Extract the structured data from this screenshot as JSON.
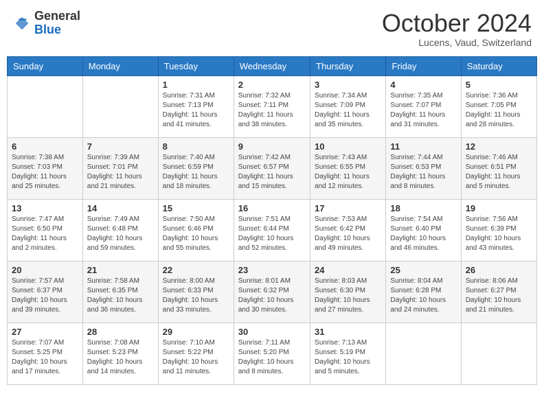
{
  "logo": {
    "general": "General",
    "blue": "Blue"
  },
  "title": "October 2024",
  "subtitle": "Lucens, Vaud, Switzerland",
  "days_of_week": [
    "Sunday",
    "Monday",
    "Tuesday",
    "Wednesday",
    "Thursday",
    "Friday",
    "Saturday"
  ],
  "weeks": [
    [
      null,
      null,
      {
        "day": "1",
        "sunrise": "7:31 AM",
        "sunset": "7:13 PM",
        "daylight": "11 hours and 41 minutes."
      },
      {
        "day": "2",
        "sunrise": "7:32 AM",
        "sunset": "7:11 PM",
        "daylight": "11 hours and 38 minutes."
      },
      {
        "day": "3",
        "sunrise": "7:34 AM",
        "sunset": "7:09 PM",
        "daylight": "11 hours and 35 minutes."
      },
      {
        "day": "4",
        "sunrise": "7:35 AM",
        "sunset": "7:07 PM",
        "daylight": "11 hours and 31 minutes."
      },
      {
        "day": "5",
        "sunrise": "7:36 AM",
        "sunset": "7:05 PM",
        "daylight": "11 hours and 28 minutes."
      }
    ],
    [
      {
        "day": "6",
        "sunrise": "7:38 AM",
        "sunset": "7:03 PM",
        "daylight": "11 hours and 25 minutes."
      },
      {
        "day": "7",
        "sunrise": "7:39 AM",
        "sunset": "7:01 PM",
        "daylight": "11 hours and 21 minutes."
      },
      {
        "day": "8",
        "sunrise": "7:40 AM",
        "sunset": "6:59 PM",
        "daylight": "11 hours and 18 minutes."
      },
      {
        "day": "9",
        "sunrise": "7:42 AM",
        "sunset": "6:57 PM",
        "daylight": "11 hours and 15 minutes."
      },
      {
        "day": "10",
        "sunrise": "7:43 AM",
        "sunset": "6:55 PM",
        "daylight": "11 hours and 12 minutes."
      },
      {
        "day": "11",
        "sunrise": "7:44 AM",
        "sunset": "6:53 PM",
        "daylight": "11 hours and 8 minutes."
      },
      {
        "day": "12",
        "sunrise": "7:46 AM",
        "sunset": "6:51 PM",
        "daylight": "11 hours and 5 minutes."
      }
    ],
    [
      {
        "day": "13",
        "sunrise": "7:47 AM",
        "sunset": "6:50 PM",
        "daylight": "11 hours and 2 minutes."
      },
      {
        "day": "14",
        "sunrise": "7:49 AM",
        "sunset": "6:48 PM",
        "daylight": "10 hours and 59 minutes."
      },
      {
        "day": "15",
        "sunrise": "7:50 AM",
        "sunset": "6:46 PM",
        "daylight": "10 hours and 55 minutes."
      },
      {
        "day": "16",
        "sunrise": "7:51 AM",
        "sunset": "6:44 PM",
        "daylight": "10 hours and 52 minutes."
      },
      {
        "day": "17",
        "sunrise": "7:53 AM",
        "sunset": "6:42 PM",
        "daylight": "10 hours and 49 minutes."
      },
      {
        "day": "18",
        "sunrise": "7:54 AM",
        "sunset": "6:40 PM",
        "daylight": "10 hours and 46 minutes."
      },
      {
        "day": "19",
        "sunrise": "7:56 AM",
        "sunset": "6:39 PM",
        "daylight": "10 hours and 43 minutes."
      }
    ],
    [
      {
        "day": "20",
        "sunrise": "7:57 AM",
        "sunset": "6:37 PM",
        "daylight": "10 hours and 39 minutes."
      },
      {
        "day": "21",
        "sunrise": "7:58 AM",
        "sunset": "6:35 PM",
        "daylight": "10 hours and 36 minutes."
      },
      {
        "day": "22",
        "sunrise": "8:00 AM",
        "sunset": "6:33 PM",
        "daylight": "10 hours and 33 minutes."
      },
      {
        "day": "23",
        "sunrise": "8:01 AM",
        "sunset": "6:32 PM",
        "daylight": "10 hours and 30 minutes."
      },
      {
        "day": "24",
        "sunrise": "8:03 AM",
        "sunset": "6:30 PM",
        "daylight": "10 hours and 27 minutes."
      },
      {
        "day": "25",
        "sunrise": "8:04 AM",
        "sunset": "6:28 PM",
        "daylight": "10 hours and 24 minutes."
      },
      {
        "day": "26",
        "sunrise": "8:06 AM",
        "sunset": "6:27 PM",
        "daylight": "10 hours and 21 minutes."
      }
    ],
    [
      {
        "day": "27",
        "sunrise": "7:07 AM",
        "sunset": "5:25 PM",
        "daylight": "10 hours and 17 minutes."
      },
      {
        "day": "28",
        "sunrise": "7:08 AM",
        "sunset": "5:23 PM",
        "daylight": "10 hours and 14 minutes."
      },
      {
        "day": "29",
        "sunrise": "7:10 AM",
        "sunset": "5:22 PM",
        "daylight": "10 hours and 11 minutes."
      },
      {
        "day": "30",
        "sunrise": "7:11 AM",
        "sunset": "5:20 PM",
        "daylight": "10 hours and 8 minutes."
      },
      {
        "day": "31",
        "sunrise": "7:13 AM",
        "sunset": "5:19 PM",
        "daylight": "10 hours and 5 minutes."
      },
      null,
      null
    ]
  ]
}
